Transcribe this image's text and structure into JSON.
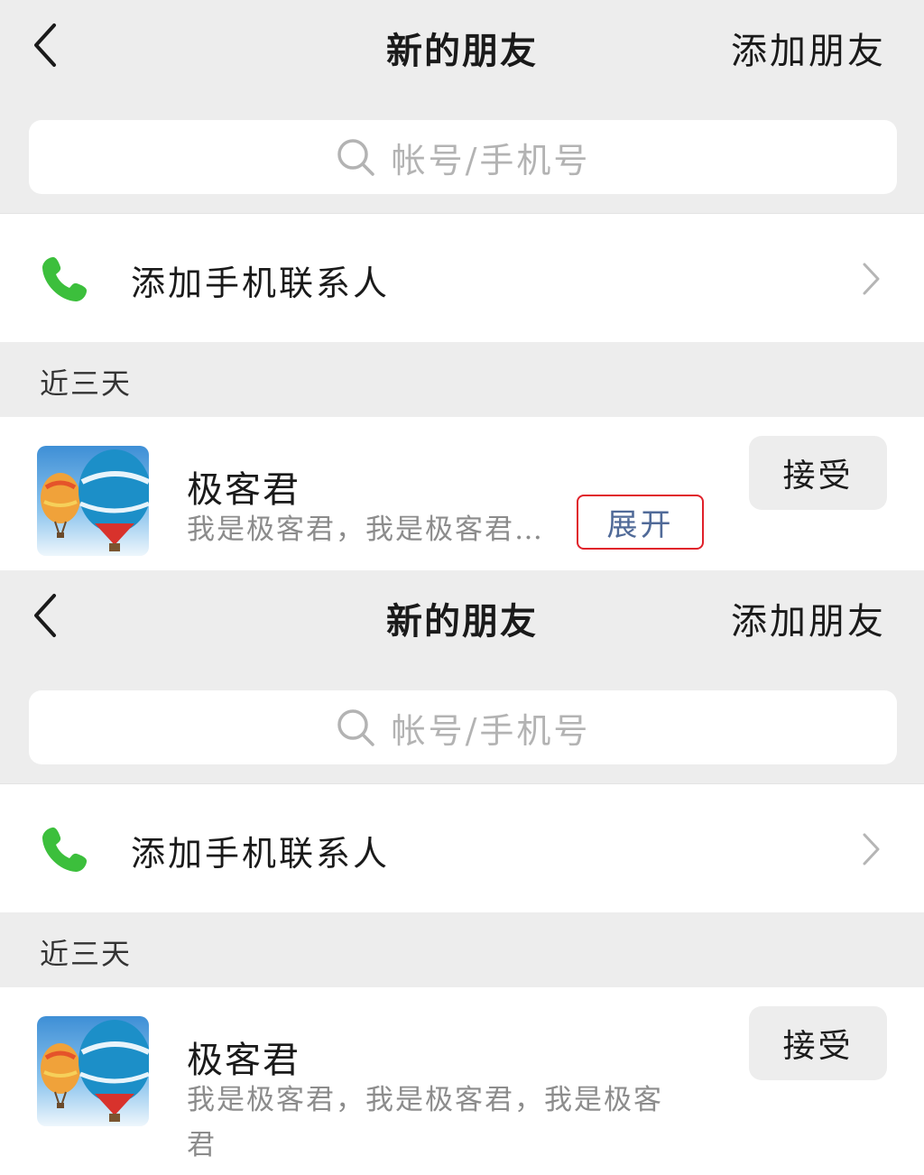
{
  "screens": [
    {
      "nav": {
        "title": "新的朋友",
        "action": "添加朋友"
      },
      "search": {
        "placeholder": "帐号/手机号"
      },
      "contacts": {
        "label": "添加手机联系人"
      },
      "section": {
        "title": "近三天"
      },
      "request": {
        "name": "极客君",
        "message": "我是极客君，我是极客君…",
        "expand_label": "展开",
        "accept_label": "接受"
      }
    },
    {
      "nav": {
        "title": "新的朋友",
        "action": "添加朋友"
      },
      "search": {
        "placeholder": "帐号/手机号"
      },
      "contacts": {
        "label": "添加手机联系人"
      },
      "section": {
        "title": "近三天"
      },
      "request": {
        "name": "极客君",
        "message": "我是极客君，我是极客君，我是极客君",
        "accept_label": "接受"
      }
    }
  ],
  "colors": {
    "phone_icon": "#3cbf3c",
    "expand_border": "#e0202a",
    "expand_text": "#506a98",
    "background": "#ededed"
  },
  "icons": [
    "back-arrow-icon",
    "search-icon",
    "phone-icon",
    "chevron-right-icon",
    "balloon-avatar"
  ]
}
